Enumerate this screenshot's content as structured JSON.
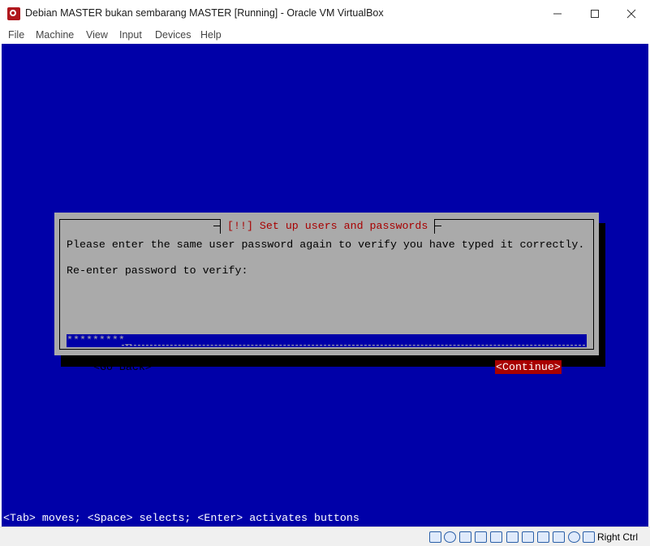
{
  "window": {
    "title": "Debian MASTER bukan sembarang MASTER [Running] - Oracle VM VirtualBox"
  },
  "menu": {
    "file": "File",
    "machine": "Machine",
    "view": "View",
    "input": "Input",
    "devices": "Devices",
    "help": "Help"
  },
  "dialog": {
    "title": "[!!] Set up users and passwords",
    "instruction": "Please enter the same user password again to verify you have typed it correctly.",
    "field_label": "Re-enter password to verify:",
    "password_mask": "*********",
    "go_back_label": "<Go Back>",
    "continue_label": "<Continue>"
  },
  "help_line": "<Tab> moves; <Space> selects; <Enter> activates buttons",
  "statusbar": {
    "icons": [
      "hard-disk-icon",
      "optical-drive-icon",
      "audio-icon",
      "network-icon",
      "usb-icon",
      "shared-folders-icon",
      "display-icon",
      "video-capture-icon",
      "cpu-icon",
      "mouse-integration-icon",
      "keyboard-icon"
    ],
    "host_key": "Right Ctrl"
  },
  "colors": {
    "console_bg": "#0000a8",
    "dialog_bg": "#aaaaaa",
    "accent_red": "#a80000"
  }
}
